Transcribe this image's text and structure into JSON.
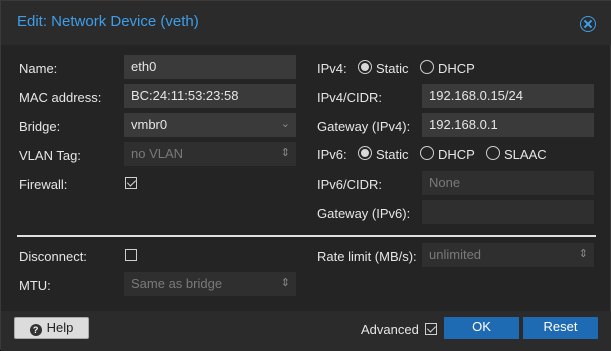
{
  "dialog": {
    "title": "Edit: Network Device (veth)"
  },
  "left": {
    "name_label": "Name:",
    "name_value": "eth0",
    "mac_label": "MAC address:",
    "mac_value": "BC:24:11:53:23:58",
    "bridge_label": "Bridge:",
    "bridge_value": "vmbr0",
    "vlan_label": "VLAN Tag:",
    "vlan_placeholder": "no VLAN",
    "firewall_label": "Firewall:",
    "firewall_checked": true
  },
  "right": {
    "ipv4_label": "IPv4:",
    "ipv4_static": "Static",
    "ipv4_dhcp": "DHCP",
    "ipv4_cidr_label": "IPv4/CIDR:",
    "ipv4_cidr_value": "192.168.0.15/24",
    "gw4_label": "Gateway (IPv4):",
    "gw4_value": "192.168.0.1",
    "ipv6_label": "IPv6:",
    "ipv6_static": "Static",
    "ipv6_dhcp": "DHCP",
    "ipv6_slaac": "SLAAC",
    "ipv6_cidr_label": "IPv6/CIDR:",
    "ipv6_cidr_placeholder": "None",
    "gw6_label": "Gateway (IPv6):"
  },
  "advanced": {
    "disconnect_label": "Disconnect:",
    "disconnect_checked": false,
    "mtu_label": "MTU:",
    "mtu_placeholder": "Same as bridge",
    "rate_label": "Rate limit (MB/s):",
    "rate_placeholder": "unlimited"
  },
  "footer": {
    "help_label": "Help",
    "advanced_label": "Advanced",
    "advanced_checked": true,
    "ok_label": "OK",
    "reset_label": "Reset"
  }
}
